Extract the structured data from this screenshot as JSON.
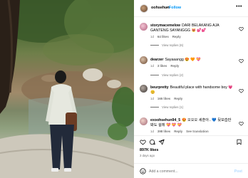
{
  "header": {
    "username": "oohsehun",
    "separator": "•",
    "follow_label": "Follow",
    "more_icon": "more-horizontal-icon"
  },
  "comments": [
    {
      "username": "storymacemelow",
      "text": "DARI BELAKANG AJA GANTENG SAYANGGG 😻 💕💕",
      "time": "1d",
      "likes": "64 likes",
      "reply_label": "Reply",
      "view_replies": "View replies (6)"
    },
    {
      "username": "dearzer",
      "text": "Sayaaangg 😍 🧡 💝",
      "time": "1d",
      "likes": "3 likes",
      "reply_label": "Reply",
      "view_replies": "View replies (2)"
    },
    {
      "username": "beurpretty",
      "text": "Beautiful place with handsome boy 💗 😊",
      "time": "1d",
      "likes": "165 likes",
      "reply_label": "Reply",
      "view_replies": "View replies (1)"
    },
    {
      "username": "exoohsehun94_5",
      "text": "😍 오오오 세훈아.. 💙 뒷모습만 봐도 설레 💝 💝 💝",
      "time": "1d",
      "likes": "398 likes",
      "reply_label": "Reply",
      "translate_label": "See translation"
    }
  ],
  "post": {
    "likes": "897K likes",
    "ago": "3 days ago"
  },
  "add_comment": {
    "placeholder": "Add a comment...",
    "post_label": "Post"
  },
  "colors": {
    "accent": "#0095f6",
    "muted": "#737373",
    "post_disabled": "#b3dbff",
    "heart_pink": "#e1306c"
  }
}
